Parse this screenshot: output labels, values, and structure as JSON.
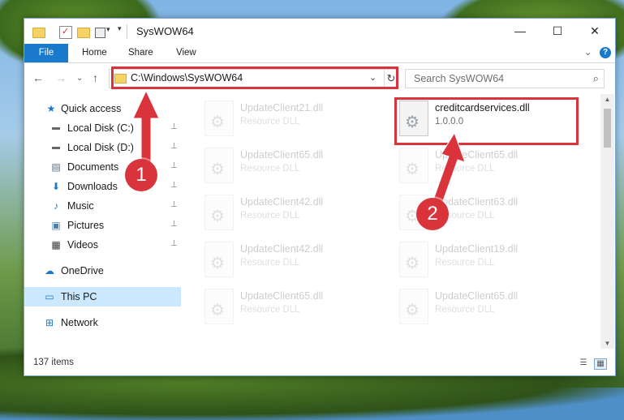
{
  "window": {
    "title": "SysWOW64",
    "controls": {
      "minimize": "—",
      "maximize": "☐",
      "close": "✕"
    }
  },
  "ribbon": {
    "file": "File",
    "tabs": [
      "Home",
      "Share",
      "View"
    ],
    "expand": "⌄",
    "help": "?"
  },
  "nav": {
    "back": "←",
    "forward": "→",
    "recent": "⌄",
    "up": "↑",
    "address": "C:\\Windows\\SysWOW64",
    "address_chevron": "⌄",
    "refresh": "↻",
    "search_placeholder": "Search SysWOW64"
  },
  "sidebar": {
    "items": [
      {
        "label": "Quick access",
        "icon": "star-icon",
        "glyph": "★",
        "pinned": false
      },
      {
        "label": "Local Disk (C:)",
        "icon": "drive-icon",
        "glyph": "▬",
        "pinned": true
      },
      {
        "label": "Local Disk (D:)",
        "icon": "drive-icon",
        "glyph": "▬",
        "pinned": true
      },
      {
        "label": "Documents",
        "icon": "documents-icon",
        "glyph": "▤",
        "pinned": true
      },
      {
        "label": "Downloads",
        "icon": "downloads-icon",
        "glyph": "⬇",
        "pinned": true
      },
      {
        "label": "Music",
        "icon": "music-icon",
        "glyph": "♪",
        "pinned": true
      },
      {
        "label": "Pictures",
        "icon": "pictures-icon",
        "glyph": "▣",
        "pinned": true
      },
      {
        "label": "Videos",
        "icon": "videos-icon",
        "glyph": "▦",
        "pinned": true
      },
      {
        "label": "OneDrive",
        "icon": "onedrive-icon",
        "glyph": "☁",
        "pinned": false
      },
      {
        "label": "This PC",
        "icon": "computer-icon",
        "glyph": "▭",
        "pinned": false,
        "selected": true
      },
      {
        "label": "Network",
        "icon": "network-icon",
        "glyph": "⊞",
        "pinned": false
      }
    ],
    "pin_glyph": "📌"
  },
  "files": {
    "left": [
      {
        "name": "UpdateClient21.dll",
        "type": "Resource DLL"
      },
      {
        "name": "UpdateClient65.dll",
        "type": "Resource DLL"
      },
      {
        "name": "UpdateClient42.dll",
        "type": "Resource DLL"
      },
      {
        "name": "UpdateClient42.dll",
        "type": "Resource DLL"
      },
      {
        "name": "UpdateClient65.dll",
        "type": "Resource DLL"
      }
    ],
    "right": [
      {
        "name": "creditcardservices.dll",
        "type": "1.0.0.0",
        "highlighted": true
      },
      {
        "name": "UpdateClient65.dll",
        "type": "Resource DLL"
      },
      {
        "name": "UpdateClient63.dll",
        "type": "Resource DLL"
      },
      {
        "name": "UpdateClient19.dll",
        "type": "Resource DLL"
      },
      {
        "name": "UpdateClient65.dll",
        "type": "Resource DLL"
      }
    ]
  },
  "status": {
    "item_count": "137 items"
  },
  "annotations": {
    "step1": "1",
    "step2": "2",
    "highlight_color": "#d9343c"
  }
}
